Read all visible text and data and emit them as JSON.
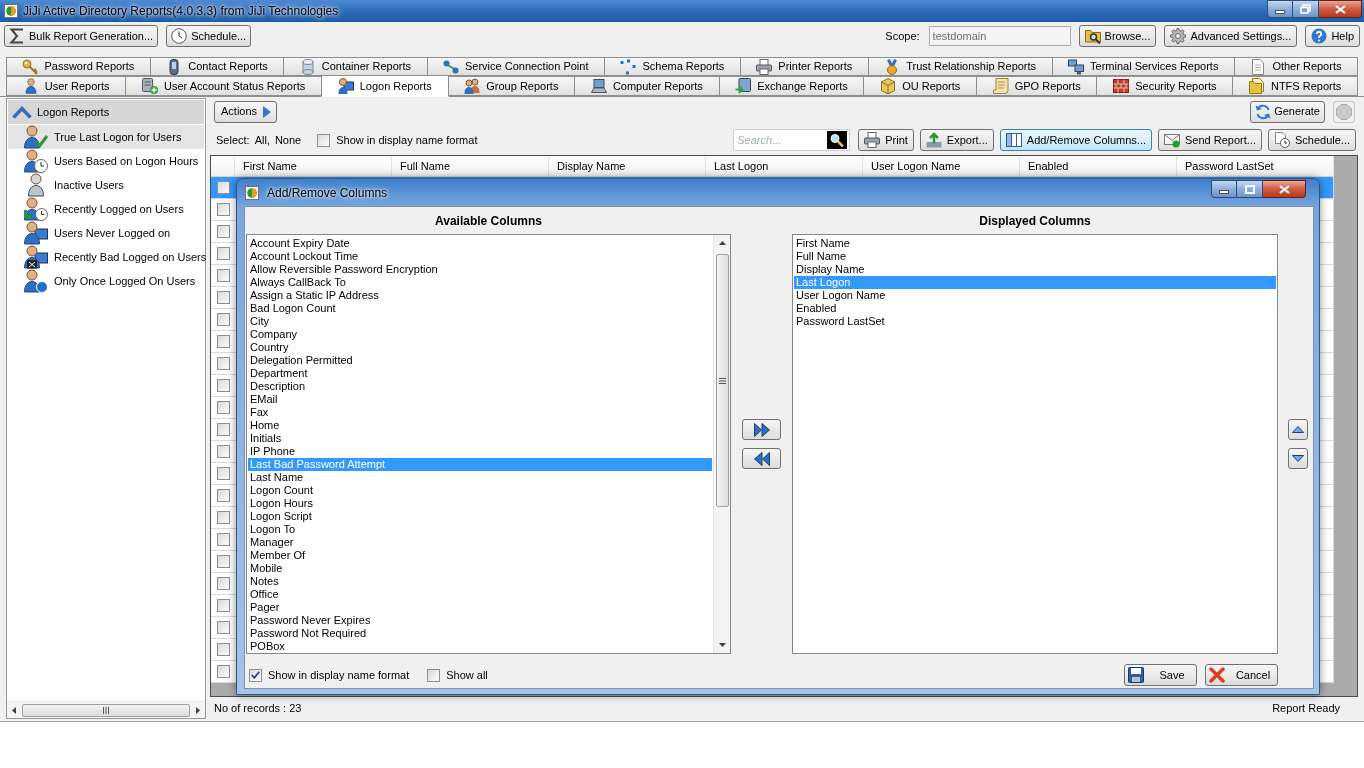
{
  "window": {
    "title": "JiJi Active Directory Reports(4.0.3.3) from JiJi Technologies"
  },
  "toolbar": {
    "left_buttons": [
      {
        "label": "Bulk Report Generation..."
      },
      {
        "label": "Schedule..."
      }
    ],
    "scope": {
      "label": "Scope:",
      "value": "testdomain"
    },
    "right_buttons": [
      {
        "label": "Browse..."
      },
      {
        "label": "Advanced Settings..."
      },
      {
        "label": "Help"
      }
    ]
  },
  "tab_rows": [
    {
      "tabs": [
        {
          "label": "Password Reports",
          "selected": false
        },
        {
          "label": "Contact Reports",
          "selected": false
        },
        {
          "label": "Container Reports",
          "selected": false
        },
        {
          "label": "Service Connection Point",
          "selected": false
        },
        {
          "label": "Schema Reports",
          "selected": false
        },
        {
          "label": "Printer Reports",
          "selected": false
        },
        {
          "label": "Trust Relationship Reports",
          "selected": false
        },
        {
          "label": "Terminal Services Reports",
          "selected": false
        },
        {
          "label": "Other Reports",
          "selected": false
        }
      ]
    },
    {
      "tabs": [
        {
          "label": "User Reports",
          "selected": false
        },
        {
          "label": "User Account Status Reports",
          "selected": false
        },
        {
          "label": "Logon Reports",
          "selected": true
        },
        {
          "label": "Group Reports",
          "selected": false
        },
        {
          "label": "Computer Reports",
          "selected": false
        },
        {
          "label": "Exchange Reports",
          "selected": false
        },
        {
          "label": "OU Reports",
          "selected": false
        },
        {
          "label": "GPO Reports",
          "selected": false
        },
        {
          "label": "Security Reports",
          "selected": false
        },
        {
          "label": "NTFS Reports",
          "selected": false
        }
      ]
    }
  ],
  "sidebar": {
    "heading": "Logon Reports",
    "items": [
      {
        "label": "True Last Logon for Users",
        "selected": true
      },
      {
        "label": "Users Based on Logon Hours",
        "selected": false
      },
      {
        "label": "Inactive Users",
        "selected": false
      },
      {
        "label": "Recently Logged on Users",
        "selected": false
      },
      {
        "label": "Users Never Logged on",
        "selected": false
      },
      {
        "label": "Recently Bad Logged on Users",
        "selected": false
      },
      {
        "label": "Only Once Logged On Users",
        "selected": false
      }
    ]
  },
  "report": {
    "actions_button": "Actions",
    "generate_button": "Generate",
    "stop_button": {
      "disabled": true
    },
    "select": {
      "label": "Select:",
      "options": [
        "All,",
        "None"
      ]
    },
    "display_name_option": {
      "label": "Show in display name format",
      "checked": false
    },
    "search": {
      "placeholder": "Search..."
    },
    "buttons": [
      {
        "label": "Print",
        "active": false
      },
      {
        "label": "Export...",
        "active": false
      },
      {
        "label": "Add/Remove Columns...",
        "active": true
      },
      {
        "label": "Send Report...",
        "active": false
      },
      {
        "label": "Schedule...",
        "active": false
      }
    ],
    "table": {
      "columns": [
        "First Name",
        "Full Name",
        "Display Name",
        "Last Logon",
        "User Logon Name",
        "Enabled",
        "Password LastSet"
      ],
      "rows": [
        {
          "selected": true,
          "checked": false
        },
        {
          "selected": false,
          "checked": false
        },
        {
          "selected": false,
          "checked": false
        },
        {
          "selected": false,
          "checked": false
        },
        {
          "selected": false,
          "checked": false
        },
        {
          "selected": false,
          "checked": false
        },
        {
          "selected": false,
          "checked": false
        },
        {
          "selected": false,
          "checked": false
        },
        {
          "selected": false,
          "checked": false
        },
        {
          "selected": false,
          "checked": false
        },
        {
          "selected": false,
          "checked": false
        },
        {
          "selected": false,
          "checked": false
        },
        {
          "selected": false,
          "checked": false
        },
        {
          "selected": false,
          "checked": false
        },
        {
          "selected": false,
          "checked": false
        },
        {
          "selected": false,
          "checked": false
        },
        {
          "selected": false,
          "checked": false
        },
        {
          "selected": false,
          "checked": false
        },
        {
          "selected": false,
          "checked": false
        },
        {
          "selected": false,
          "checked": false
        },
        {
          "selected": false,
          "checked": false
        },
        {
          "selected": false,
          "checked": false
        },
        {
          "selected": false,
          "checked": false
        }
      ]
    }
  },
  "dialog": {
    "title": "Add/Remove Columns",
    "available": {
      "heading": "Available Columns",
      "items": [
        {
          "label": "Account Expiry Date",
          "selected": false
        },
        {
          "label": "Account Lockout Time",
          "selected": false
        },
        {
          "label": "Allow Reversible Password Encryption",
          "selected": false
        },
        {
          "label": "Always CallBack To",
          "selected": false
        },
        {
          "label": "Assign a Static IP Address",
          "selected": false
        },
        {
          "label": "Bad Logon Count",
          "selected": false
        },
        {
          "label": "City",
          "selected": false
        },
        {
          "label": "Company",
          "selected": false
        },
        {
          "label": "Country",
          "selected": false
        },
        {
          "label": "Delegation Permitted",
          "selected": false
        },
        {
          "label": "Department",
          "selected": false
        },
        {
          "label": "Description",
          "selected": false
        },
        {
          "label": "EMail",
          "selected": false
        },
        {
          "label": "Fax",
          "selected": false
        },
        {
          "label": "Home",
          "selected": false
        },
        {
          "label": "Initials",
          "selected": false
        },
        {
          "label": "IP Phone",
          "selected": false
        },
        {
          "label": "Last Bad Password Attempt",
          "selected": true
        },
        {
          "label": "Last Name",
          "selected": false
        },
        {
          "label": "Logon Count",
          "selected": false
        },
        {
          "label": "Logon Hours",
          "selected": false
        },
        {
          "label": "Logon Script",
          "selected": false
        },
        {
          "label": "Logon To",
          "selected": false
        },
        {
          "label": "Manager",
          "selected": false
        },
        {
          "label": "Member Of",
          "selected": false
        },
        {
          "label": "Mobile",
          "selected": false
        },
        {
          "label": "Notes",
          "selected": false
        },
        {
          "label": "Office",
          "selected": false
        },
        {
          "label": "Pager",
          "selected": false
        },
        {
          "label": "Password Never Expires",
          "selected": false
        },
        {
          "label": "Password Not Required",
          "selected": false
        },
        {
          "label": "POBox",
          "selected": false
        }
      ]
    },
    "displayed": {
      "heading": "Displayed Columns",
      "items": [
        {
          "label": "First Name",
          "selected": false
        },
        {
          "label": "Full Name",
          "selected": false
        },
        {
          "label": "Display Name",
          "selected": false
        },
        {
          "label": "Last Logon",
          "selected": true
        },
        {
          "label": "User Logon Name",
          "selected": false
        },
        {
          "label": "Enabled",
          "selected": false
        },
        {
          "label": "Password LastSet",
          "selected": false
        }
      ]
    },
    "options": [
      {
        "label": "Show in display name format",
        "checked": true
      },
      {
        "label": "Show all",
        "checked": false
      }
    ],
    "buttons": [
      {
        "label": "Save"
      },
      {
        "label": "Cancel"
      }
    ]
  },
  "status_bar": {
    "records": "No of records : 23",
    "status": "Report Ready"
  }
}
